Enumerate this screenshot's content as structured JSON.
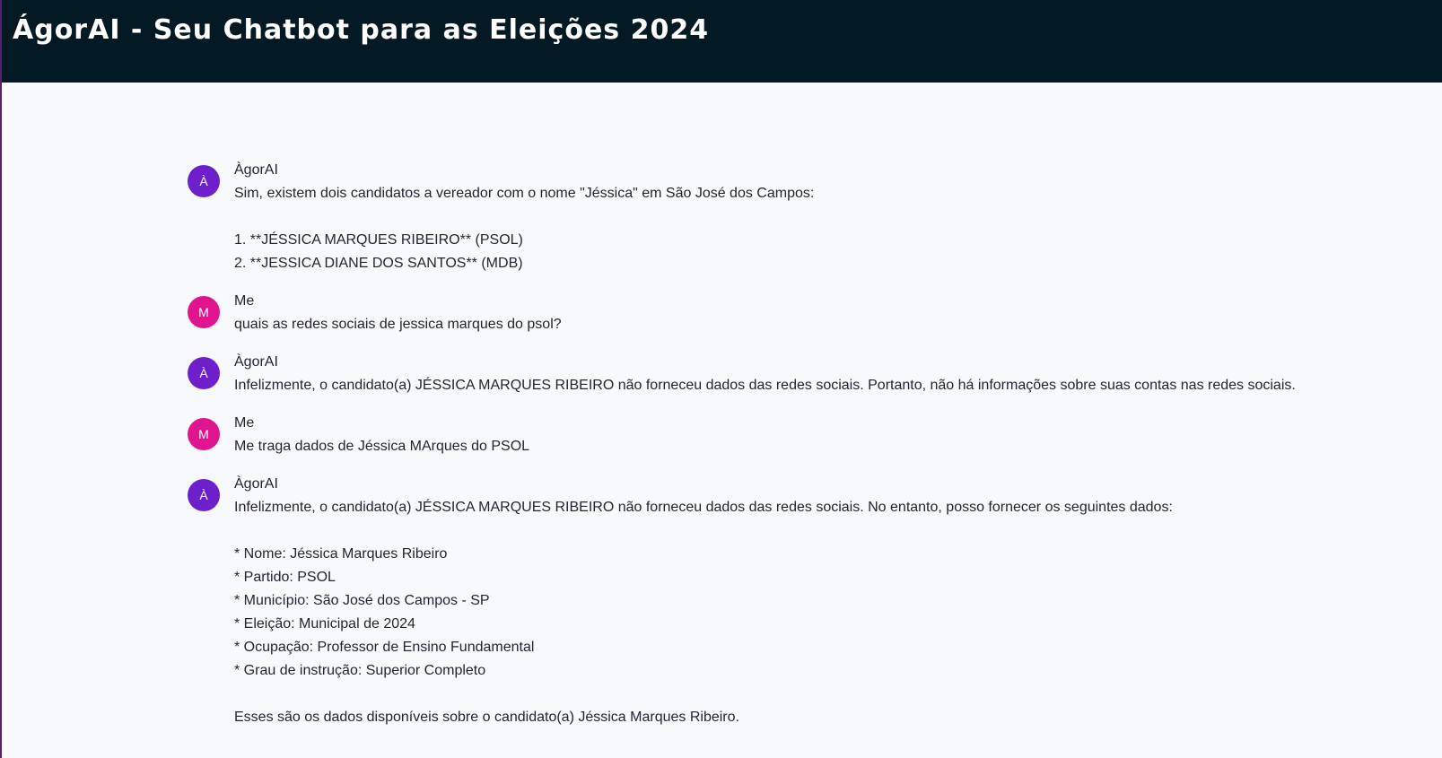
{
  "header": {
    "title": "ÁgorAI - Seu Chatbot para as Eleições 2024",
    "background": "#031a24"
  },
  "colors": {
    "bot_avatar": "#6d1fcc",
    "user_avatar": "#e0148e"
  },
  "messages": [
    {
      "role": "bot",
      "avatar": "À",
      "sender": "ÀgorAI",
      "lines": [
        "Sim, existem dois candidatos a vereador com o nome \"Jéssica\" em São José dos Campos:",
        "",
        "1. **JÉSSICA MARQUES RIBEIRO** (PSOL)",
        "2. **JESSICA DIANE DOS SANTOS** (MDB)"
      ]
    },
    {
      "role": "me",
      "avatar": "M",
      "sender": "Me",
      "lines": [
        "quais as redes sociais de jessica marques do psol?"
      ]
    },
    {
      "role": "bot",
      "avatar": "À",
      "sender": "ÀgorAI",
      "lines": [
        "Infelizmente, o candidato(a) JÉSSICA MARQUES RIBEIRO não forneceu dados das redes sociais. Portanto, não há informações sobre suas contas nas redes sociais."
      ]
    },
    {
      "role": "me",
      "avatar": "M",
      "sender": "Me",
      "lines": [
        "Me traga dados de Jéssica MArques do PSOL"
      ]
    },
    {
      "role": "bot",
      "avatar": "À",
      "sender": "ÀgorAI",
      "lines": [
        "Infelizmente, o candidato(a) JÉSSICA MARQUES RIBEIRO não forneceu dados das redes sociais. No entanto, posso fornecer os seguintes dados:",
        "",
        "* Nome: Jéssica Marques Ribeiro",
        "* Partido: PSOL",
        "* Município: São José dos Campos - SP",
        "* Eleição: Municipal de 2024",
        "* Ocupação: Professor de Ensino Fundamental",
        "* Grau de instrução: Superior Completo",
        "",
        "Esses são os dados disponíveis sobre o candidato(a) Jéssica Marques Ribeiro."
      ]
    }
  ]
}
